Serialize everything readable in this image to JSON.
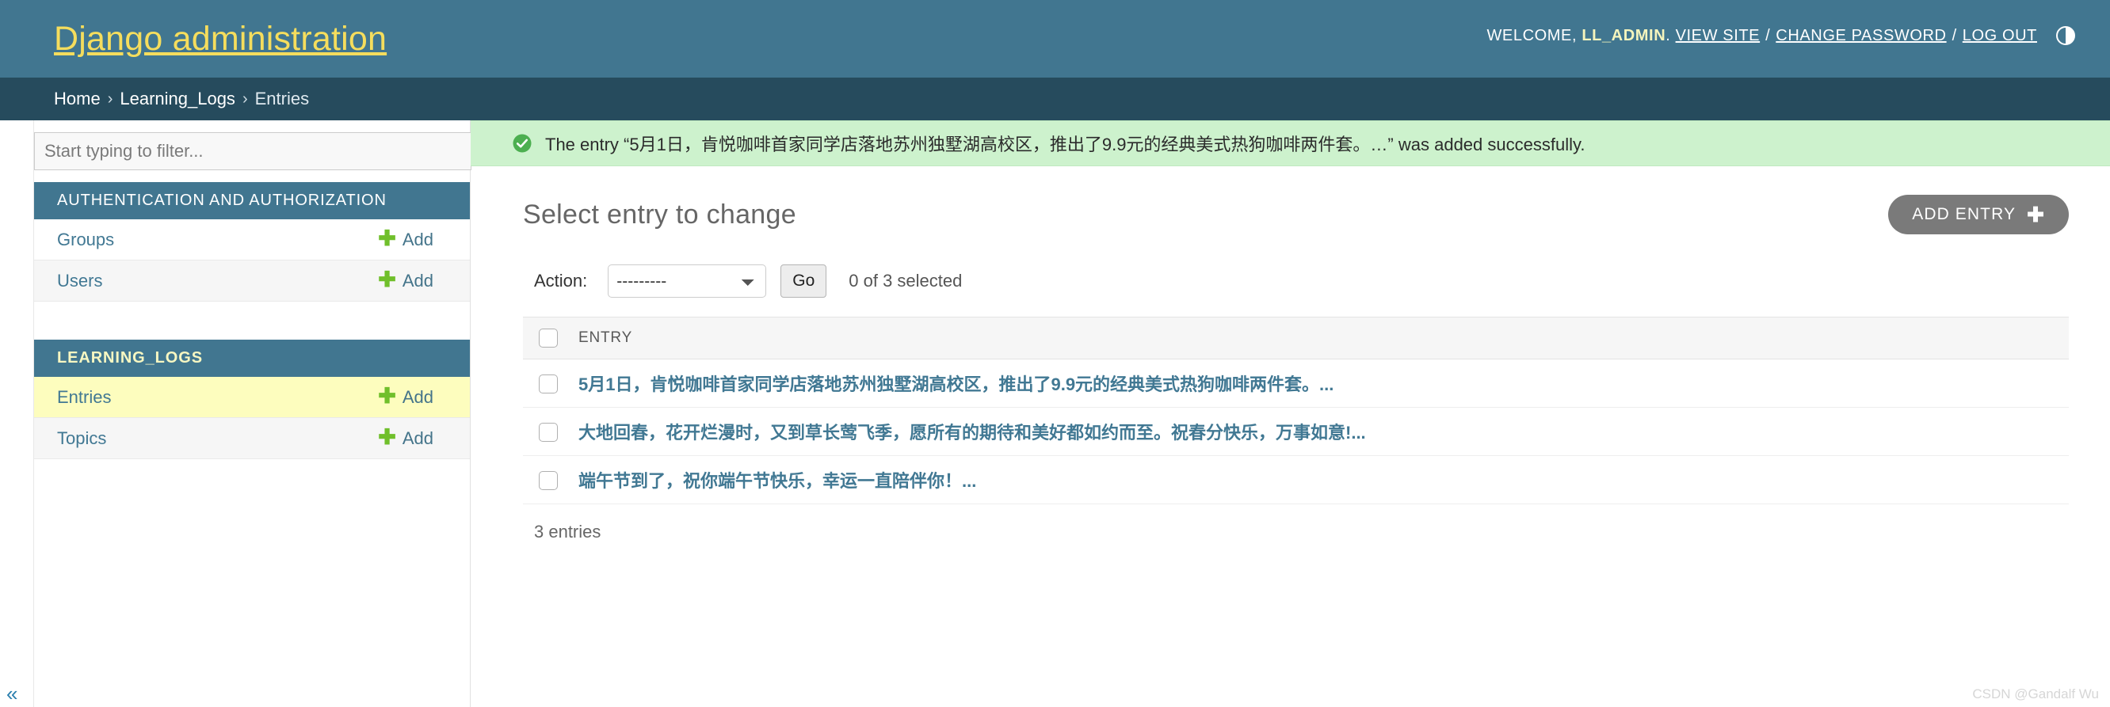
{
  "header": {
    "site_name": "Django administration",
    "welcome_prefix": "WELCOME,",
    "username": "LL_ADMIN",
    "username_suffix": ".",
    "view_site": "VIEW SITE",
    "change_password": "CHANGE PASSWORD",
    "log_out": "LOG OUT",
    "separator": "/",
    "theme_toggle_icon": "theme-half-circle-icon",
    "brand_color": "#417690",
    "brand_text_color": "#f5dd5d"
  },
  "breadcrumbs": {
    "items": [
      "Home",
      "Learning_Logs",
      "Entries"
    ],
    "separator": "›",
    "bar_color": "#264b5d"
  },
  "sidebar": {
    "filter_placeholder": "Start typing to filter...",
    "filter_value": "",
    "collapse_icon": "double-chevron-left-icon",
    "apps": [
      {
        "caption": "AUTHENTICATION AND AUTHORIZATION",
        "current": false,
        "models": [
          {
            "label": "Groups",
            "add_label": "Add",
            "current": false
          },
          {
            "label": "Users",
            "add_label": "Add",
            "current": false
          }
        ]
      },
      {
        "caption": "LEARNING_LOGS",
        "current": true,
        "models": [
          {
            "label": "Entries",
            "add_label": "Add",
            "current": true
          },
          {
            "label": "Topics",
            "add_label": "Add",
            "current": false
          }
        ]
      }
    ]
  },
  "message": {
    "icon": "success-check-circle-icon",
    "text": "The entry “5月1日，肯悦咖啡首家同学店落地苏州独墅湖高校区，推出了9.9元的经典美式热狗咖啡两件套。…” was added successfully.",
    "background_color": "#cdf2cd"
  },
  "main": {
    "title": "Select entry to change",
    "add_button_label": "ADD ENTRY",
    "add_button_icon": "plus-icon",
    "action_label": "Action:",
    "action_selected": "---------",
    "action_options": [
      "---------"
    ],
    "go_label": "Go",
    "action_counter": "0 of 3 selected",
    "select_all_checkbox": false,
    "columns": [
      "ENTRY"
    ],
    "rows": [
      {
        "entry": "5月1日，肯悦咖啡首家同学店落地苏州独墅湖高校区，推出了9.9元的经典美式热狗咖啡两件套。...",
        "selected": false
      },
      {
        "entry": "大地回春，花开烂漫时，又到草长莺飞季，愿所有的期待和美好都如约而至。祝春分快乐，万事如意!...",
        "selected": false
      },
      {
        "entry": "端午节到了，祝你端午节快乐，幸运一直陪伴你！...",
        "selected": false
      }
    ],
    "pagination": "3 entries"
  },
  "watermark": "CSDN @Gandalf Wu"
}
